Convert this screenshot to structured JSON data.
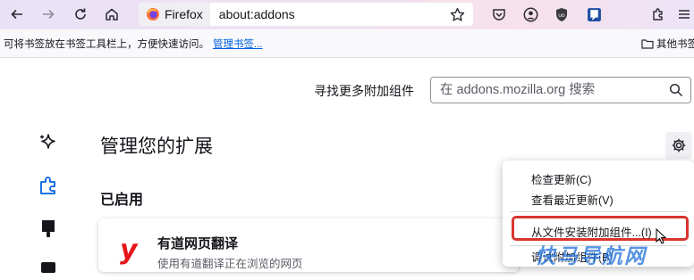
{
  "toolbar": {
    "identity_label": "Firefox",
    "url": "about:addons"
  },
  "bookmarks_bar": {
    "hint": "可将书签放在书签工具栏上，方便快速访问。",
    "manage_link": "管理书签...",
    "other_bookmarks": "其他书签"
  },
  "search": {
    "label": "寻找更多附加组件",
    "placeholder": "在 addons.mozilla.org 搜索"
  },
  "page": {
    "title": "管理您的扩展",
    "section_enabled": "已启用"
  },
  "extension": {
    "name": "有道网页翻译",
    "description": "使用有道翻译正在浏览的网页",
    "icon_letter": "y"
  },
  "gear_menu": {
    "items": [
      "检查更新(C)",
      "查看最近更新(V)",
      "从文件安装附加组件...(I)",
      "调试附加组件(B)"
    ]
  },
  "watermark": "快马导航网",
  "colors": {
    "accent": "#0060df",
    "highlight_border": "#d9352f",
    "extension_icon": "#e5151b"
  }
}
